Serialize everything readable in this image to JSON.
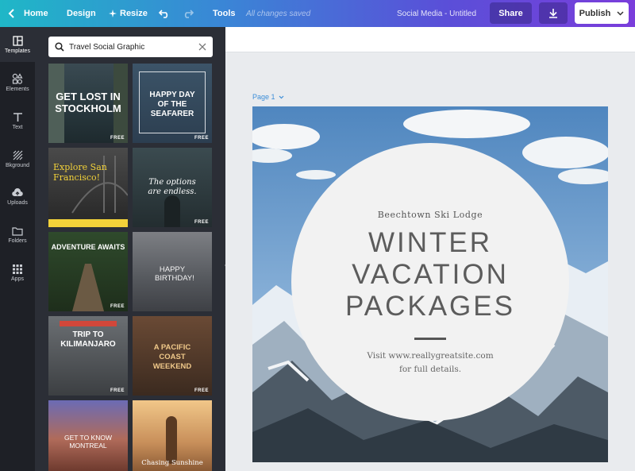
{
  "topbar": {
    "home_label": "Home",
    "design_label": "Design",
    "resize_label": "Resize",
    "tools_label": "Tools",
    "saved_status": "All changes saved",
    "doc_title": "Social Media - Untitled",
    "share_label": "Share",
    "publish_label": "Publish"
  },
  "rail": {
    "items": [
      {
        "label": "Templates",
        "icon": "templates-icon"
      },
      {
        "label": "Elements",
        "icon": "elements-icon"
      },
      {
        "label": "Text",
        "icon": "text-icon"
      },
      {
        "label": "Bkground",
        "icon": "background-icon"
      },
      {
        "label": "Uploads",
        "icon": "uploads-icon"
      },
      {
        "label": "Folders",
        "icon": "folders-icon"
      },
      {
        "label": "Apps",
        "icon": "apps-icon"
      }
    ]
  },
  "panel": {
    "search_value": "Travel Social Graphic",
    "free_badge": "FREE",
    "templates": [
      {
        "title": "GET LOST IN STOCKHOLM"
      },
      {
        "title": "HAPPY DAY OF THE SEAFARER"
      },
      {
        "title": "Explore San Francisco!"
      },
      {
        "title": "The options are endless."
      },
      {
        "title": "ADVENTURE AWAITS"
      },
      {
        "title": "HAPPY BIRTHDAY!"
      },
      {
        "title": "TRIP TO KILIMANJARO"
      },
      {
        "title": "A PACIFIC COAST WEEKEND"
      },
      {
        "title": "GET TO KNOW MONTREAL"
      },
      {
        "title": "Chasing Sunshine"
      }
    ]
  },
  "canvas": {
    "page_label": "Page 1",
    "design": {
      "lodge": "Beechtown Ski Lodge",
      "headline_1": "WINTER",
      "headline_2": "VACATION",
      "headline_3": "PACKAGES",
      "visit_1": "Visit www.reallygreatsite.com",
      "visit_2": "for full details."
    }
  },
  "colors": {
    "accent_blue": "#3d8ed8",
    "rail_bg": "#1e2026",
    "panel_bg": "#2b2e36"
  }
}
